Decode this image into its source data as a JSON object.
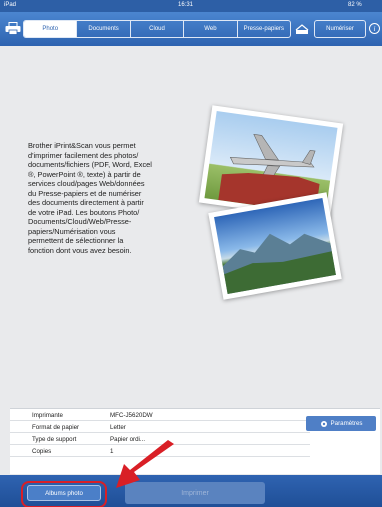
{
  "status": {
    "device": "iPad",
    "time": "16:31",
    "battery": "82 %"
  },
  "toolbar": {
    "tabs": [
      {
        "label": "Photo",
        "active": true
      },
      {
        "label": "Documents",
        "active": false
      },
      {
        "label": "Cloud",
        "active": false
      },
      {
        "label": "Web",
        "active": false
      },
      {
        "label": "Presse-papiers",
        "active": false
      }
    ],
    "scan_label": "Numériser",
    "info_glyph": "i",
    "icons": {
      "printer": "printer-icon",
      "scan": "scanner-icon",
      "info": "info-icon"
    },
    "colors": {
      "bar": "#2e63b0",
      "tab_active_bg": "#ffffff"
    }
  },
  "description": "Brother iPrint&Scan vous permet\nd'imprimer facilement des photos/\ndocuments/fichiers (PDF, Word, Excel\n®, PowerPoint ®, texte) à partir de\nservices cloud/pages Web/données\ndu Presse-papiers et de numériser\ndes documents directement à partir\nde votre iPad.  Les boutons Photo/\nDocuments/Cloud/Web/Presse-\npapiers/Numérisation vous\npermettent de sélectionner la\nfonction dont vous avez besoin.",
  "settings": {
    "rows": [
      {
        "label": "Imprimante",
        "value": "MFC-J5620DW"
      },
      {
        "label": "Format de papier",
        "value": "Letter"
      },
      {
        "label": "Type de support",
        "value": "Papier ordi..."
      },
      {
        "label": "Copies",
        "value": "1"
      }
    ],
    "params_label": "Paramètres"
  },
  "bottom": {
    "album_label": "Albums photo",
    "print_label": "Imprimer"
  },
  "annotation": {
    "highlight_color": "#d91f26"
  }
}
